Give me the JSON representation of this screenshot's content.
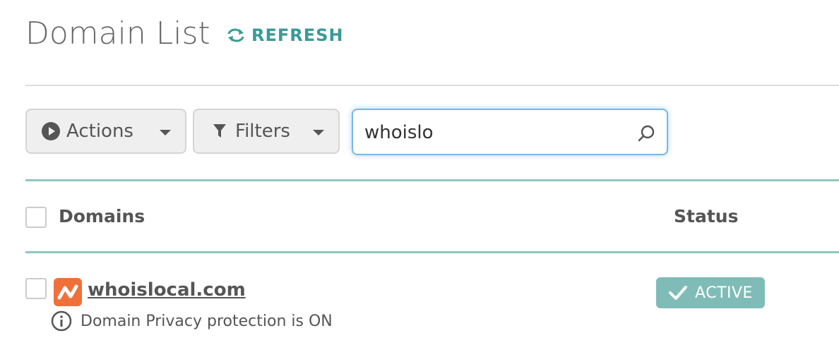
{
  "header": {
    "title": "Domain List",
    "refresh_label": "REFRESH"
  },
  "toolbar": {
    "actions_label": "Actions",
    "filters_label": "Filters",
    "search_value": "whoislo"
  },
  "table": {
    "columns": [
      "Domains",
      "Status"
    ],
    "rows": [
      {
        "domain": "whoislocal.com",
        "note": "Domain Privacy protection is ON",
        "status": "ACTIVE"
      }
    ]
  },
  "colors": {
    "accent": "#3a9a98",
    "teal_rule": "#8cc9c2",
    "status_active": "#80bcb7",
    "favicon": "#f0703a"
  },
  "icons": [
    "refresh-icon",
    "play-icon",
    "filter-icon",
    "search-icon",
    "favicon-icon",
    "info-icon",
    "check-icon"
  ]
}
